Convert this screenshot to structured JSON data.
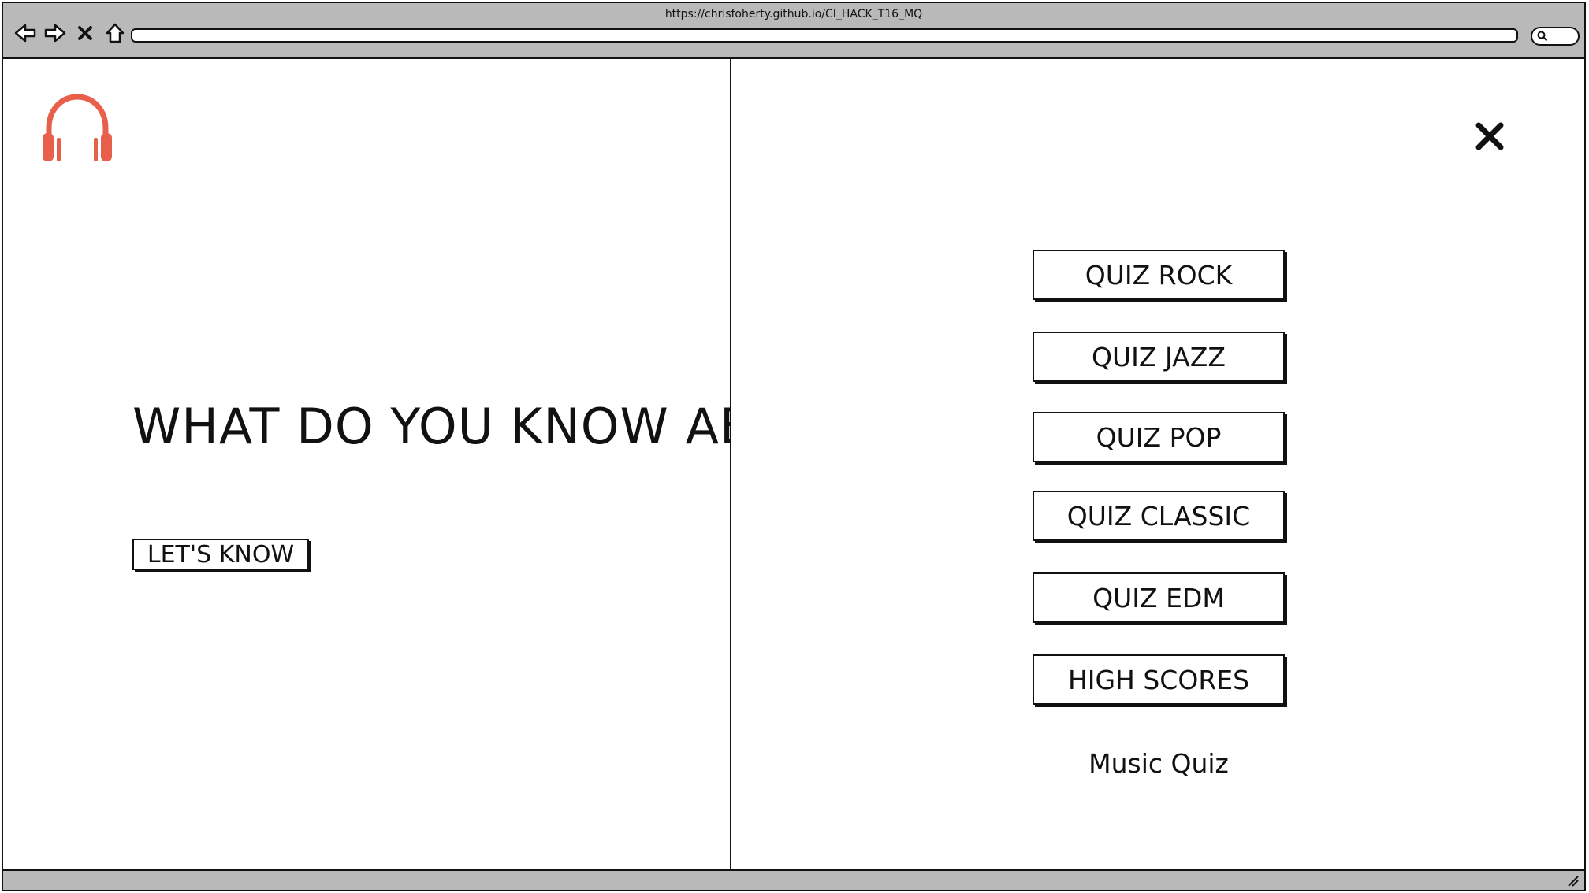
{
  "browser": {
    "url": "https://chrisfoherty.github.io/CI_HACK_T16_MQ",
    "nav": [
      "back-icon",
      "forward-icon",
      "close-icon",
      "home-icon"
    ],
    "search_icon": "search-icon"
  },
  "hero": {
    "title": "WHAT DO YOU KNOW ABOUT MUSIC?",
    "button": "LET'S KNOW"
  },
  "menu": {
    "items": [
      "QUIZ ROCK",
      "QUIZ JAZZ",
      "QUIZ POP",
      "QUIZ CLASSIC",
      "QUIZ EDM",
      "HIGH SCORES"
    ],
    "footer": "Music Quiz"
  },
  "colors": {
    "chrome": "#b9b9b9",
    "accent": "#e8604c",
    "text": "#111111"
  }
}
